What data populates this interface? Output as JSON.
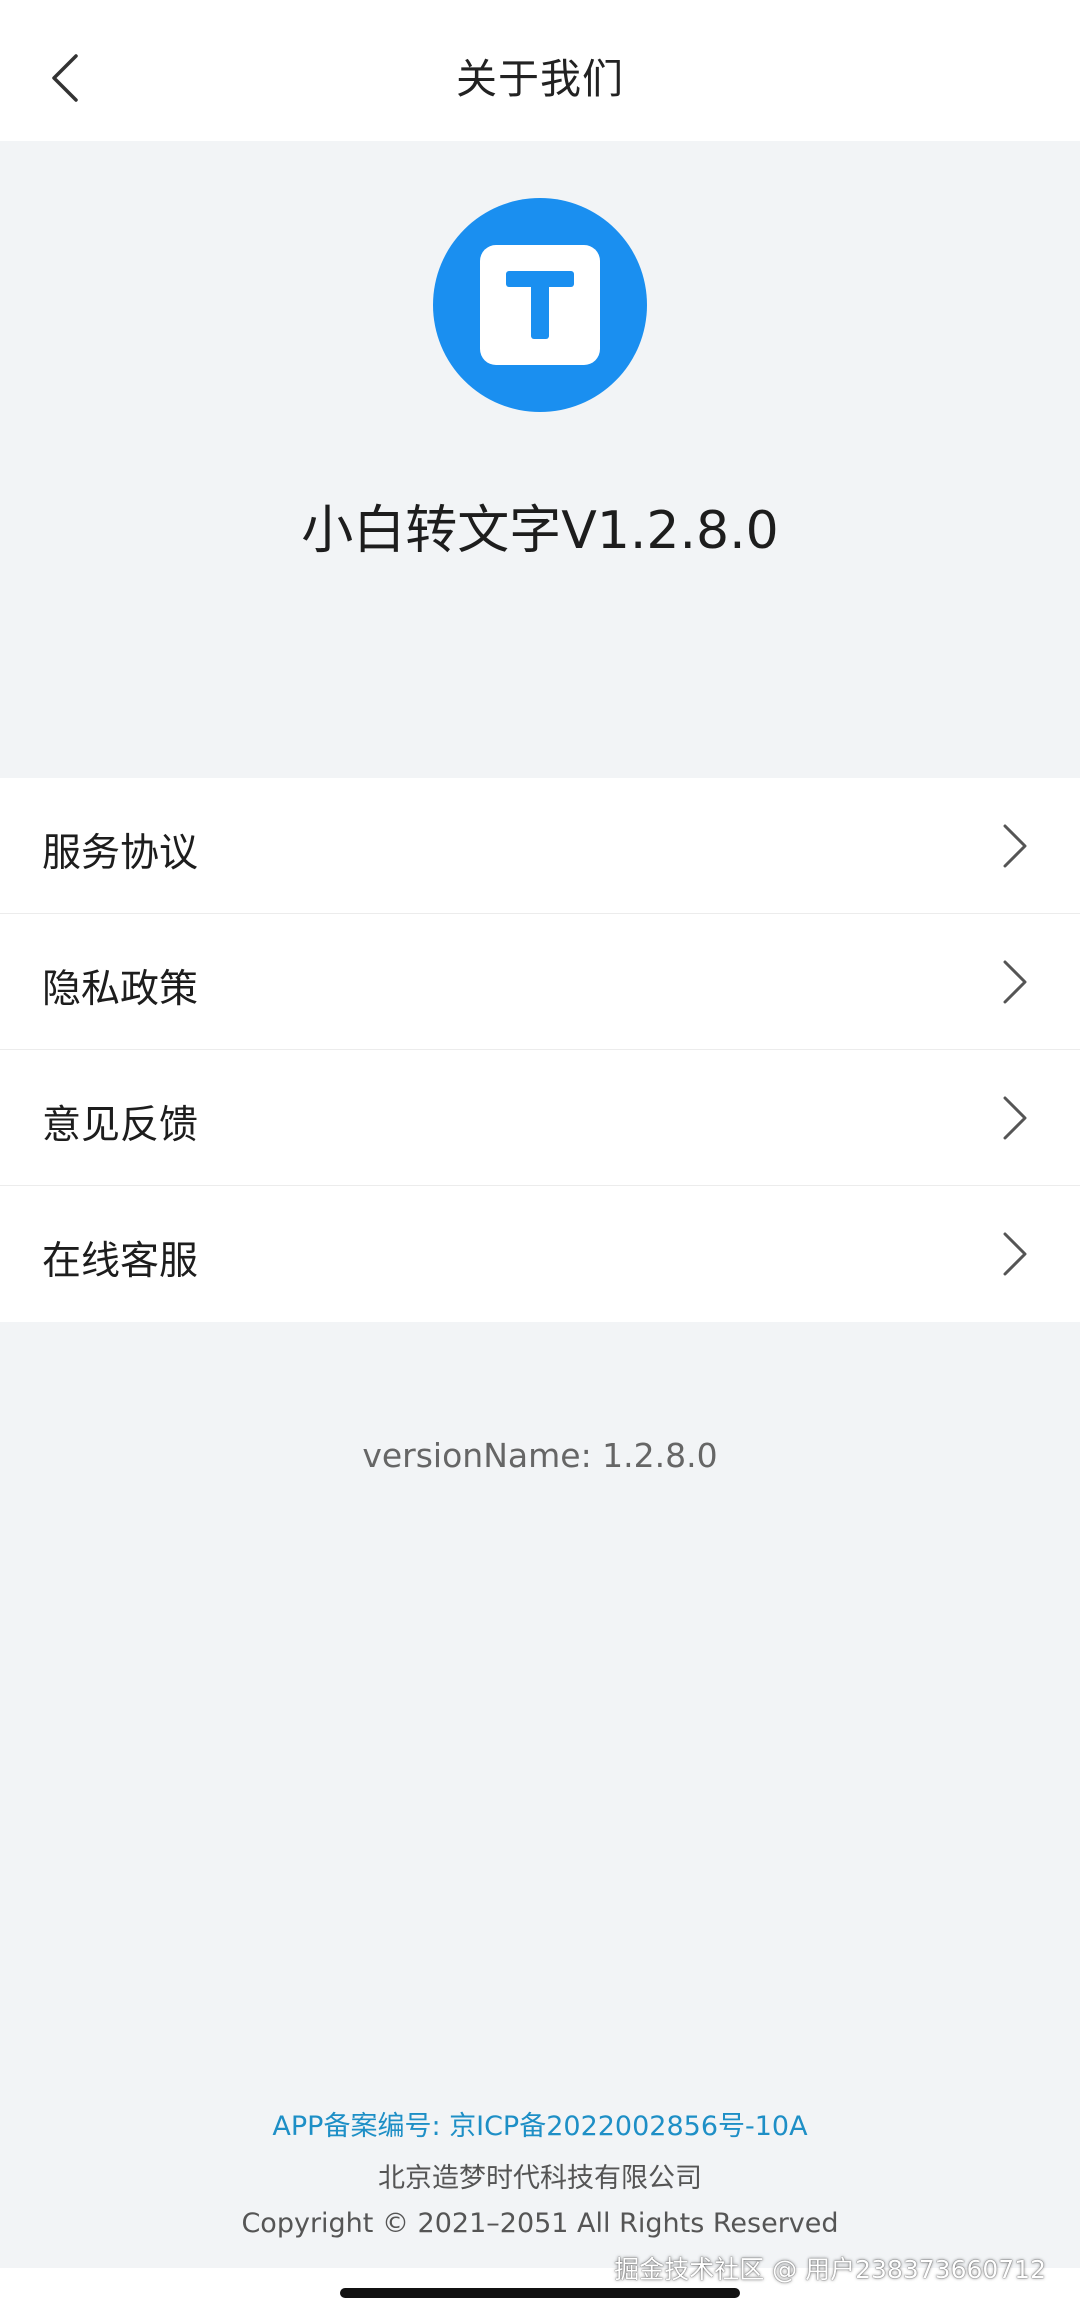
{
  "header": {
    "title": "关于我们",
    "back_icon": "chevron-left-icon"
  },
  "app": {
    "logo_icon": "t-logo-icon",
    "name": "小白转文字V1.2.8.0",
    "brand_color": "#1a8ff0"
  },
  "menu": {
    "items": [
      {
        "label": "服务协议"
      },
      {
        "label": "隐私政策"
      },
      {
        "label": "意见反馈"
      },
      {
        "label": "在线客服"
      }
    ],
    "chevron_icon": "chevron-right-icon"
  },
  "version_text": "versionName: 1.2.8.0",
  "footer": {
    "icp": "APP备案编号: 京ICP备2022002856号-10A",
    "company": "北京造梦时代科技有限公司",
    "copyright": "Copyright © 2021–2051 All Rights Reserved",
    "link_color": "#1e8fc6"
  },
  "watermark": "掘金技术社区 @ 用户238373660712"
}
